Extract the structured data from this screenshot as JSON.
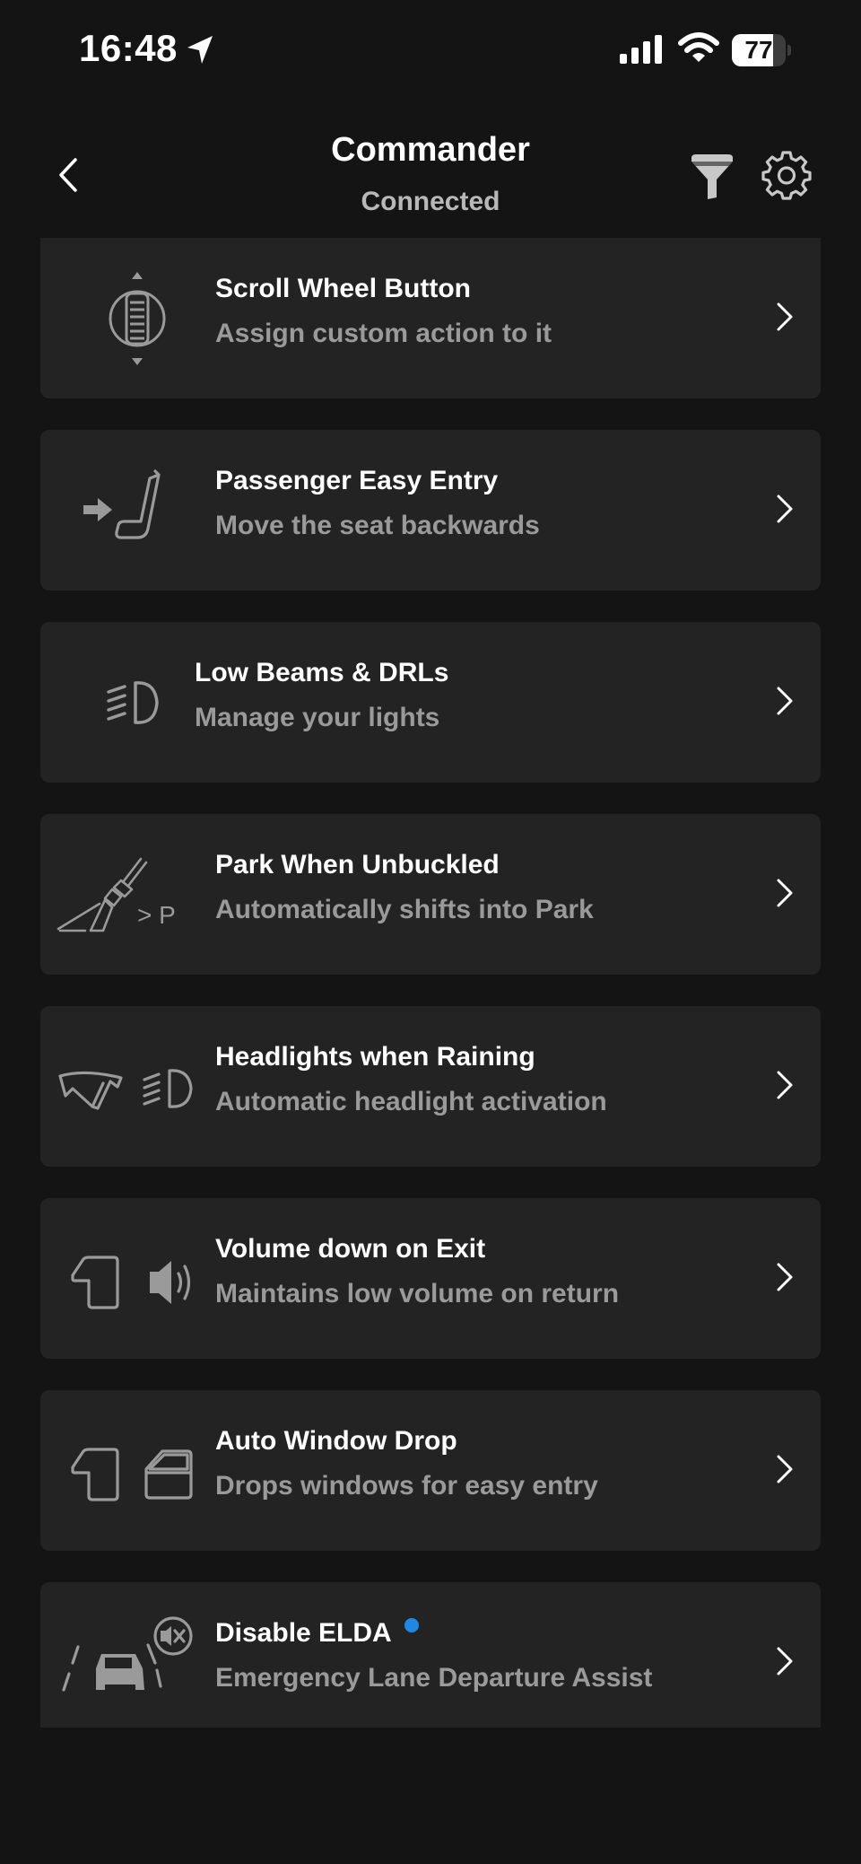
{
  "status_bar": {
    "time": "16:48",
    "battery_level": "77"
  },
  "header": {
    "title": "Commander",
    "subtitle": "Connected"
  },
  "icons": {
    "back": "chevron-left-icon",
    "filter": "filter-icon",
    "settings": "gear-icon",
    "row_chevron": "chevron-right-icon"
  },
  "colors": {
    "background": "#141414",
    "card": "#232323",
    "subtitle": "#9a9a9a",
    "accent_dot": "#1e88e5"
  },
  "items": [
    {
      "title": "Scroll Wheel Button",
      "subtitle": "Assign custom action to it",
      "icon": "scroll-wheel-icon"
    },
    {
      "title": "Passenger Easy Entry",
      "subtitle": "Move the seat backwards",
      "icon": "seat-backward-icon"
    },
    {
      "title": "Low Beams & DRLs",
      "subtitle": "Manage your lights",
      "icon": "low-beam-icon"
    },
    {
      "title": "Park When Unbuckled",
      "subtitle": "Automatically shifts into Park",
      "icon": "seatbelt-park-icon",
      "icon_label": "> P"
    },
    {
      "title": "Headlights when Raining",
      "subtitle": "Automatic headlight activation",
      "icon": "wiper-headlight-icon"
    },
    {
      "title": "Volume down on Exit",
      "subtitle": "Maintains low volume on return",
      "icon": "door-volume-icon"
    },
    {
      "title": "Auto Window Drop",
      "subtitle": "Drops windows for easy entry",
      "icon": "door-window-icon"
    },
    {
      "title": "Disable ELDA",
      "subtitle": "Emergency Lane Departure Assist",
      "icon": "lane-assist-off-icon",
      "new_badge": true
    }
  ]
}
